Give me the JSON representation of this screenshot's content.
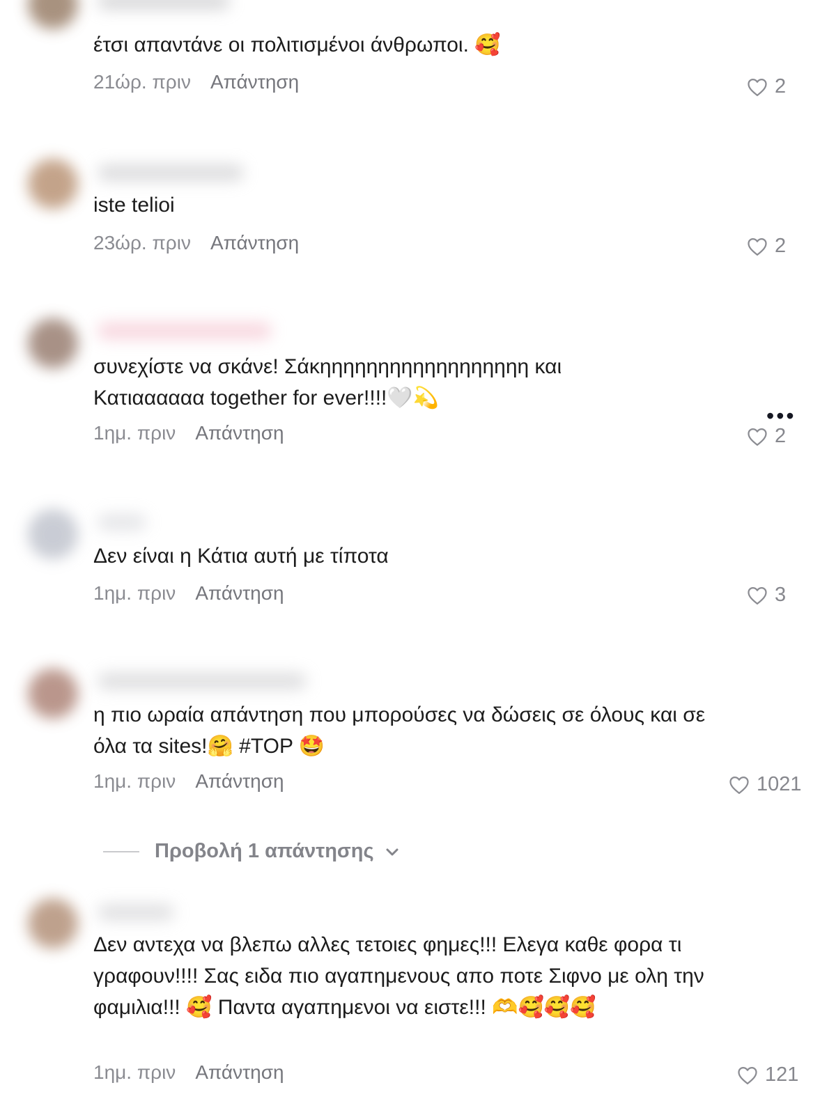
{
  "comments": [
    {
      "text": "έτσι απαντάνε οι πολιτισμένοι άνθρωποι. 🥰",
      "time": "21ώρ. πριν",
      "reply": "Απάντηση",
      "likes": "2",
      "avatar_color": "#8c6e55",
      "username_color": "#b9b9bc"
    },
    {
      "text": "iste telioi",
      "time": "23ώρ. πριν",
      "reply": "Απάντηση",
      "likes": "2",
      "avatar_color": "#b08563",
      "username_color": "#c0c0c3"
    },
    {
      "text": "συνεχίστε να σκάνε! Σάκηηηηηηηηηηηηηηηηηη και Κατιαααααα together for ever!!!!🤍💫",
      "time": "1ημ. πριν",
      "reply": "Απάντηση",
      "likes": "2",
      "avatar_color": "#8b6d5e",
      "username_color": "#f2b5c4"
    },
    {
      "text": "Δεν είναι η Κάτια αυτή με τίποτα",
      "time": "1ημ. πριν",
      "reply": "Απάντηση",
      "likes": "3",
      "avatar_color": "#b8bcc7",
      "username_color": "#d0d1d6"
    },
    {
      "text": "η πιο ωραία απάντηση που μπορούσες να δώσεις σε όλους και σε όλα τα sites!🤗 #TOP 🤩",
      "time": "1ημ. πριν",
      "reply": "Απάντηση",
      "likes": "1021",
      "avatar_color": "#a37466",
      "username_color": "#c4c4c7"
    },
    {
      "text": "Δεν αντεχα να βλεπω αλλες τετοιες φημες!!! Ελεγα καθε φορα τι γραφουν!!!! Σας ειδα πιο αγαπημενους απο ποτε Σιφνο με ολη την φαμιλια!!! 🥰 Παντα αγαπημενοι να ειστε!!! 🫶🥰🥰🥰",
      "time": "1ημ. πριν",
      "reply": "Απάντηση",
      "likes": "121",
      "avatar_color": "#a98267",
      "username_color": "#c8c8cb"
    }
  ],
  "view_replies": {
    "label": "Προβολή 1 απάντησης",
    "chevron": "chevron-down-icon"
  },
  "more_menu": {
    "label": "•••",
    "icon": "more-icon"
  },
  "like_icon": "heart-outline-icon"
}
